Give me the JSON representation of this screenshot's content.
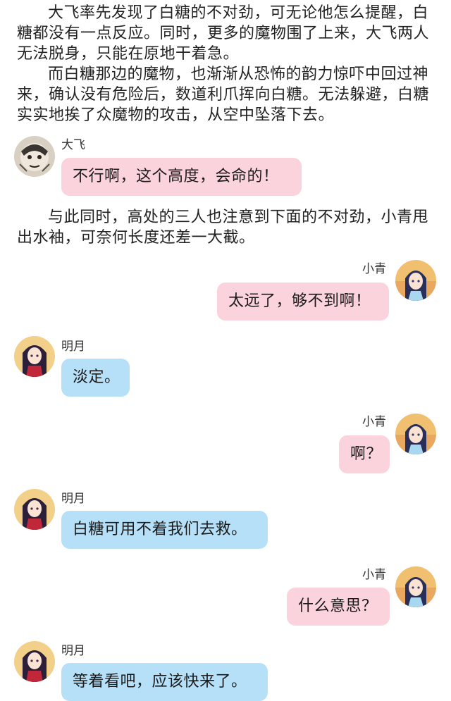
{
  "story": {
    "p1": "大飞率先发现了白糖的不对劲，可无论他怎么提醒，白糖都没有一点反应。同时，更多的魔物围了上来，大飞两人无法脱身，只能在原地干着急。",
    "p2": "而白糖那边的魔物，也渐渐从恐怖的韵力惊吓中回过神来，确认没有危险后，数道利爪挥向白糖。无法躲避，白糖实实地挨了众魔物的攻击，从空中坠落下去。",
    "p3": "与此同时，高处的三人也注意到下面的不对劲，小青甩出水袖，可奈何长度还差一大截。"
  },
  "messages": [
    {
      "speaker": "大飞",
      "text": "不行啊，这个高度，会命的！",
      "avatar": "dafei-avatar"
    },
    {
      "speaker": "小青",
      "text": "太远了，够不到啊！",
      "avatar": "xiaoqing-avatar"
    },
    {
      "speaker": "明月",
      "text": "淡定。",
      "avatar": "mingyue-avatar"
    },
    {
      "speaker": "小青",
      "text": "啊？",
      "avatar": "xiaoqing-avatar"
    },
    {
      "speaker": "明月",
      "text": "白糖可用不着我们去救。",
      "avatar": "mingyue-avatar"
    },
    {
      "speaker": "小青",
      "text": "什么意思？",
      "avatar": "xiaoqing-avatar"
    },
    {
      "speaker": "明月",
      "text": "等着看吧，应该快来了。",
      "avatar": "mingyue-avatar"
    }
  ],
  "colors": {
    "pink_bubble": "#fbd3dc",
    "blue_bubble": "#b5e0f8"
  }
}
